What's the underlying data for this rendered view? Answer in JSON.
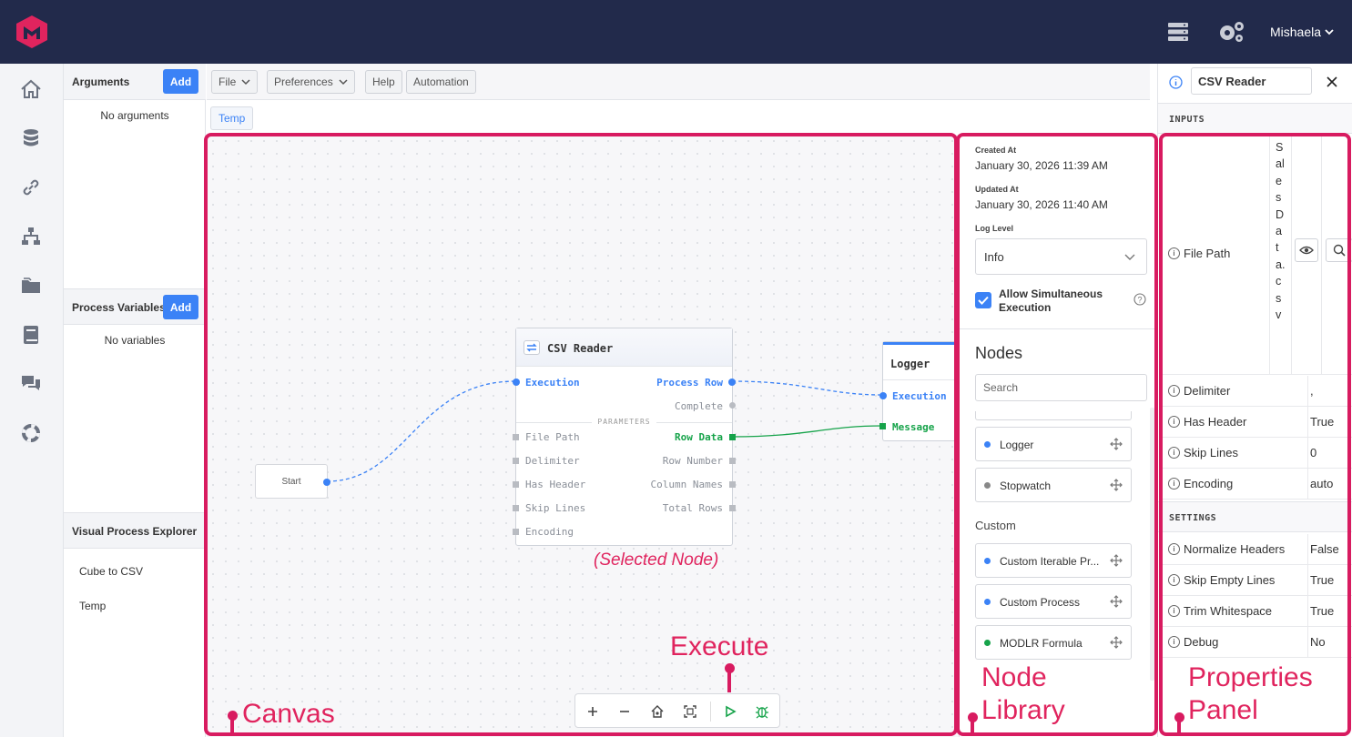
{
  "header": {
    "user_name": "Mishaela",
    "colors": {
      "bar": "#222a4b",
      "logo": "#e0245e"
    }
  },
  "nav_icons": [
    "home-icon",
    "database-icon",
    "link-icon",
    "hierarchy-icon",
    "folder-icon",
    "book-icon",
    "chat-icon",
    "lifebuoy-icon"
  ],
  "arguments": {
    "title": "Arguments",
    "add_label": "Add",
    "empty": "No arguments"
  },
  "process_variables": {
    "title": "Process Variables",
    "add_label": "Add",
    "empty": "No variables"
  },
  "explorer": {
    "title": "Visual Process Explorer",
    "items": [
      "Cube to CSV",
      "Temp"
    ]
  },
  "toolbar": {
    "file": "File",
    "preferences": "Preferences",
    "help": "Help",
    "automation": "Automation"
  },
  "tabs": [
    "Temp"
  ],
  "canvas": {
    "start_label": "Start",
    "csv_node": {
      "title": "CSV Reader",
      "inputs": [
        "Execution"
      ],
      "outputs": [
        "Process Row",
        "Complete",
        "Row Data",
        "Row Number",
        "Column Names",
        "Total Rows"
      ],
      "params_label": "PARAMETERS",
      "params": [
        "File Path",
        "Delimiter",
        "Has Header",
        "Skip Lines",
        "Encoding"
      ]
    },
    "logger_node": {
      "title": "Logger",
      "inputs": [
        "Execution",
        "Message"
      ]
    },
    "selected_caption": "(Selected Node)"
  },
  "library": {
    "created_label": "Created At",
    "created_value": "January 30, 2026 11:39 AM",
    "updated_label": "Updated At",
    "updated_value": "January 30, 2026 11:40 AM",
    "log_level_label": "Log Level",
    "log_level_value": "Info",
    "allow_label": "Allow Simultaneous Execution",
    "allow_checked": true,
    "nodes_heading": "Nodes",
    "search_placeholder": "Search",
    "items": [
      {
        "label": "Logger",
        "color": "#3b82f6"
      },
      {
        "label": "Stopwatch",
        "color": "#888888"
      }
    ],
    "custom_heading": "Custom",
    "custom_items": [
      {
        "label": "Custom Iterable Pr...",
        "color": "#3b82f6"
      },
      {
        "label": "Custom Process",
        "color": "#3b82f6"
      },
      {
        "label": "MODLR Formula",
        "color": "#16a34a"
      }
    ]
  },
  "properties": {
    "title": "CSV Reader",
    "inputs_heading": "INPUTS",
    "file_path_label": "File Path",
    "file_path_value": "SalesData.csv",
    "inputs": [
      {
        "key": "Delimiter",
        "value": ","
      },
      {
        "key": "Has Header",
        "value": "True"
      },
      {
        "key": "Skip Lines",
        "value": "0"
      },
      {
        "key": "Encoding",
        "value": "auto"
      }
    ],
    "settings_heading": "SETTINGS",
    "settings": [
      {
        "key": "Normalize Headers",
        "value": "False"
      },
      {
        "key": "Skip Empty Lines",
        "value": "True"
      },
      {
        "key": "Trim Whitespace",
        "value": "True"
      },
      {
        "key": "Debug",
        "value": "No"
      }
    ]
  },
  "annotations": {
    "canvas": "Canvas",
    "execute": "Execute",
    "node_library_1": "Node",
    "node_library_2": "Library",
    "properties_1": "Properties",
    "properties_2": "Panel"
  }
}
